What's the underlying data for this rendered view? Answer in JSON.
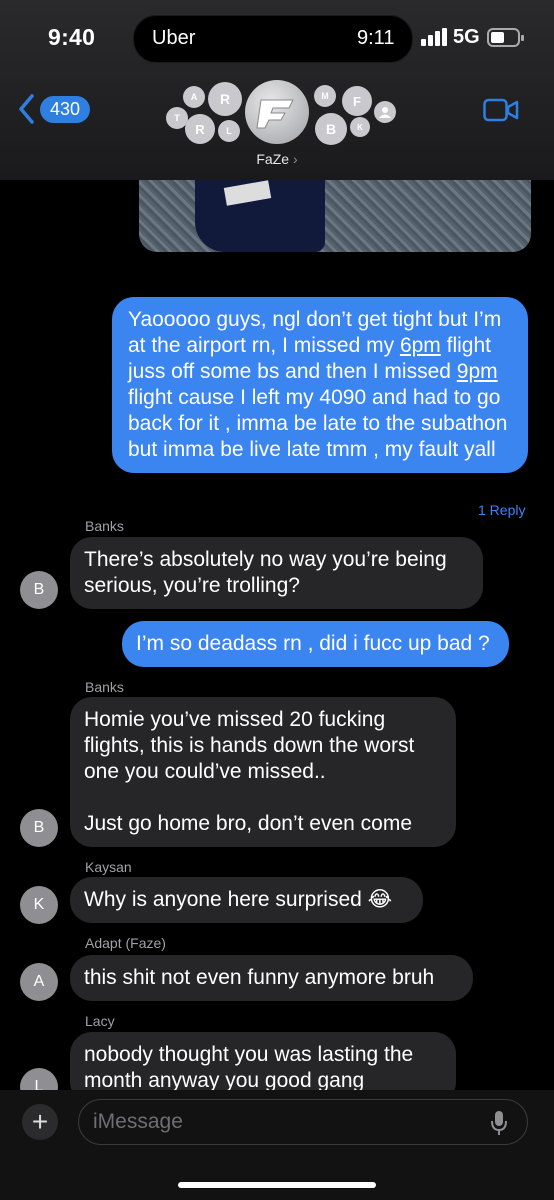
{
  "status": {
    "time": "9:40",
    "island_app": "Uber",
    "island_time": "9:11",
    "network": "5G"
  },
  "header": {
    "back_count": "430",
    "group_name": "FaZe",
    "chevron": "›",
    "member_initials": [
      "T",
      "A",
      "R",
      "R",
      "L",
      "M",
      "F",
      "B",
      "K"
    ]
  },
  "messages": [
    {
      "type": "sent",
      "parts": [
        "Yaooooo guys, ngl don’t get tight but I’m at the airport rn, I missed my ",
        "6pm",
        " flight juss off some bs and then I missed ",
        "9pm",
        " flight cause I left my 4090 and had to go back for it , imma be late to the subathon but imma be live late tmm , my fault yall"
      ]
    },
    {
      "type": "reply_link",
      "text": "1 Reply"
    },
    {
      "type": "recv",
      "sender": "Banks",
      "avatar": "B",
      "text": "There’s absolutely no way you’re being serious, you’re trolling?"
    },
    {
      "type": "sent",
      "text": "I’m so deadass rn , did i fucc up bad ?"
    },
    {
      "type": "recv",
      "sender": "Banks",
      "avatar": "B",
      "text1": "Homie you’ve missed 20 fucking flights, this is hands down the worst one you could’ve missed..",
      "text2": "Just go home bro, don’t even come"
    },
    {
      "type": "recv",
      "sender": "Kaysan",
      "avatar": "K",
      "text": "Why is anyone here surprised 😂"
    },
    {
      "type": "recv",
      "sender": "Adapt (Faze)",
      "avatar": "A",
      "text": "this shit not even funny anymore bruh"
    },
    {
      "type": "recv",
      "sender": "Lacy",
      "avatar": "L",
      "text": "nobody thought you was lasting the month anyway you good gang"
    }
  ],
  "composer": {
    "placeholder": "iMessage",
    "plus": "+"
  },
  "colors": {
    "sent": "#3a85f0",
    "received": "#262629",
    "accent": "#2f7fe0"
  },
  "icons": [
    "back-chevron-icon",
    "video-call-icon",
    "microphone-icon",
    "signal-bars-icon",
    "battery-icon"
  ]
}
